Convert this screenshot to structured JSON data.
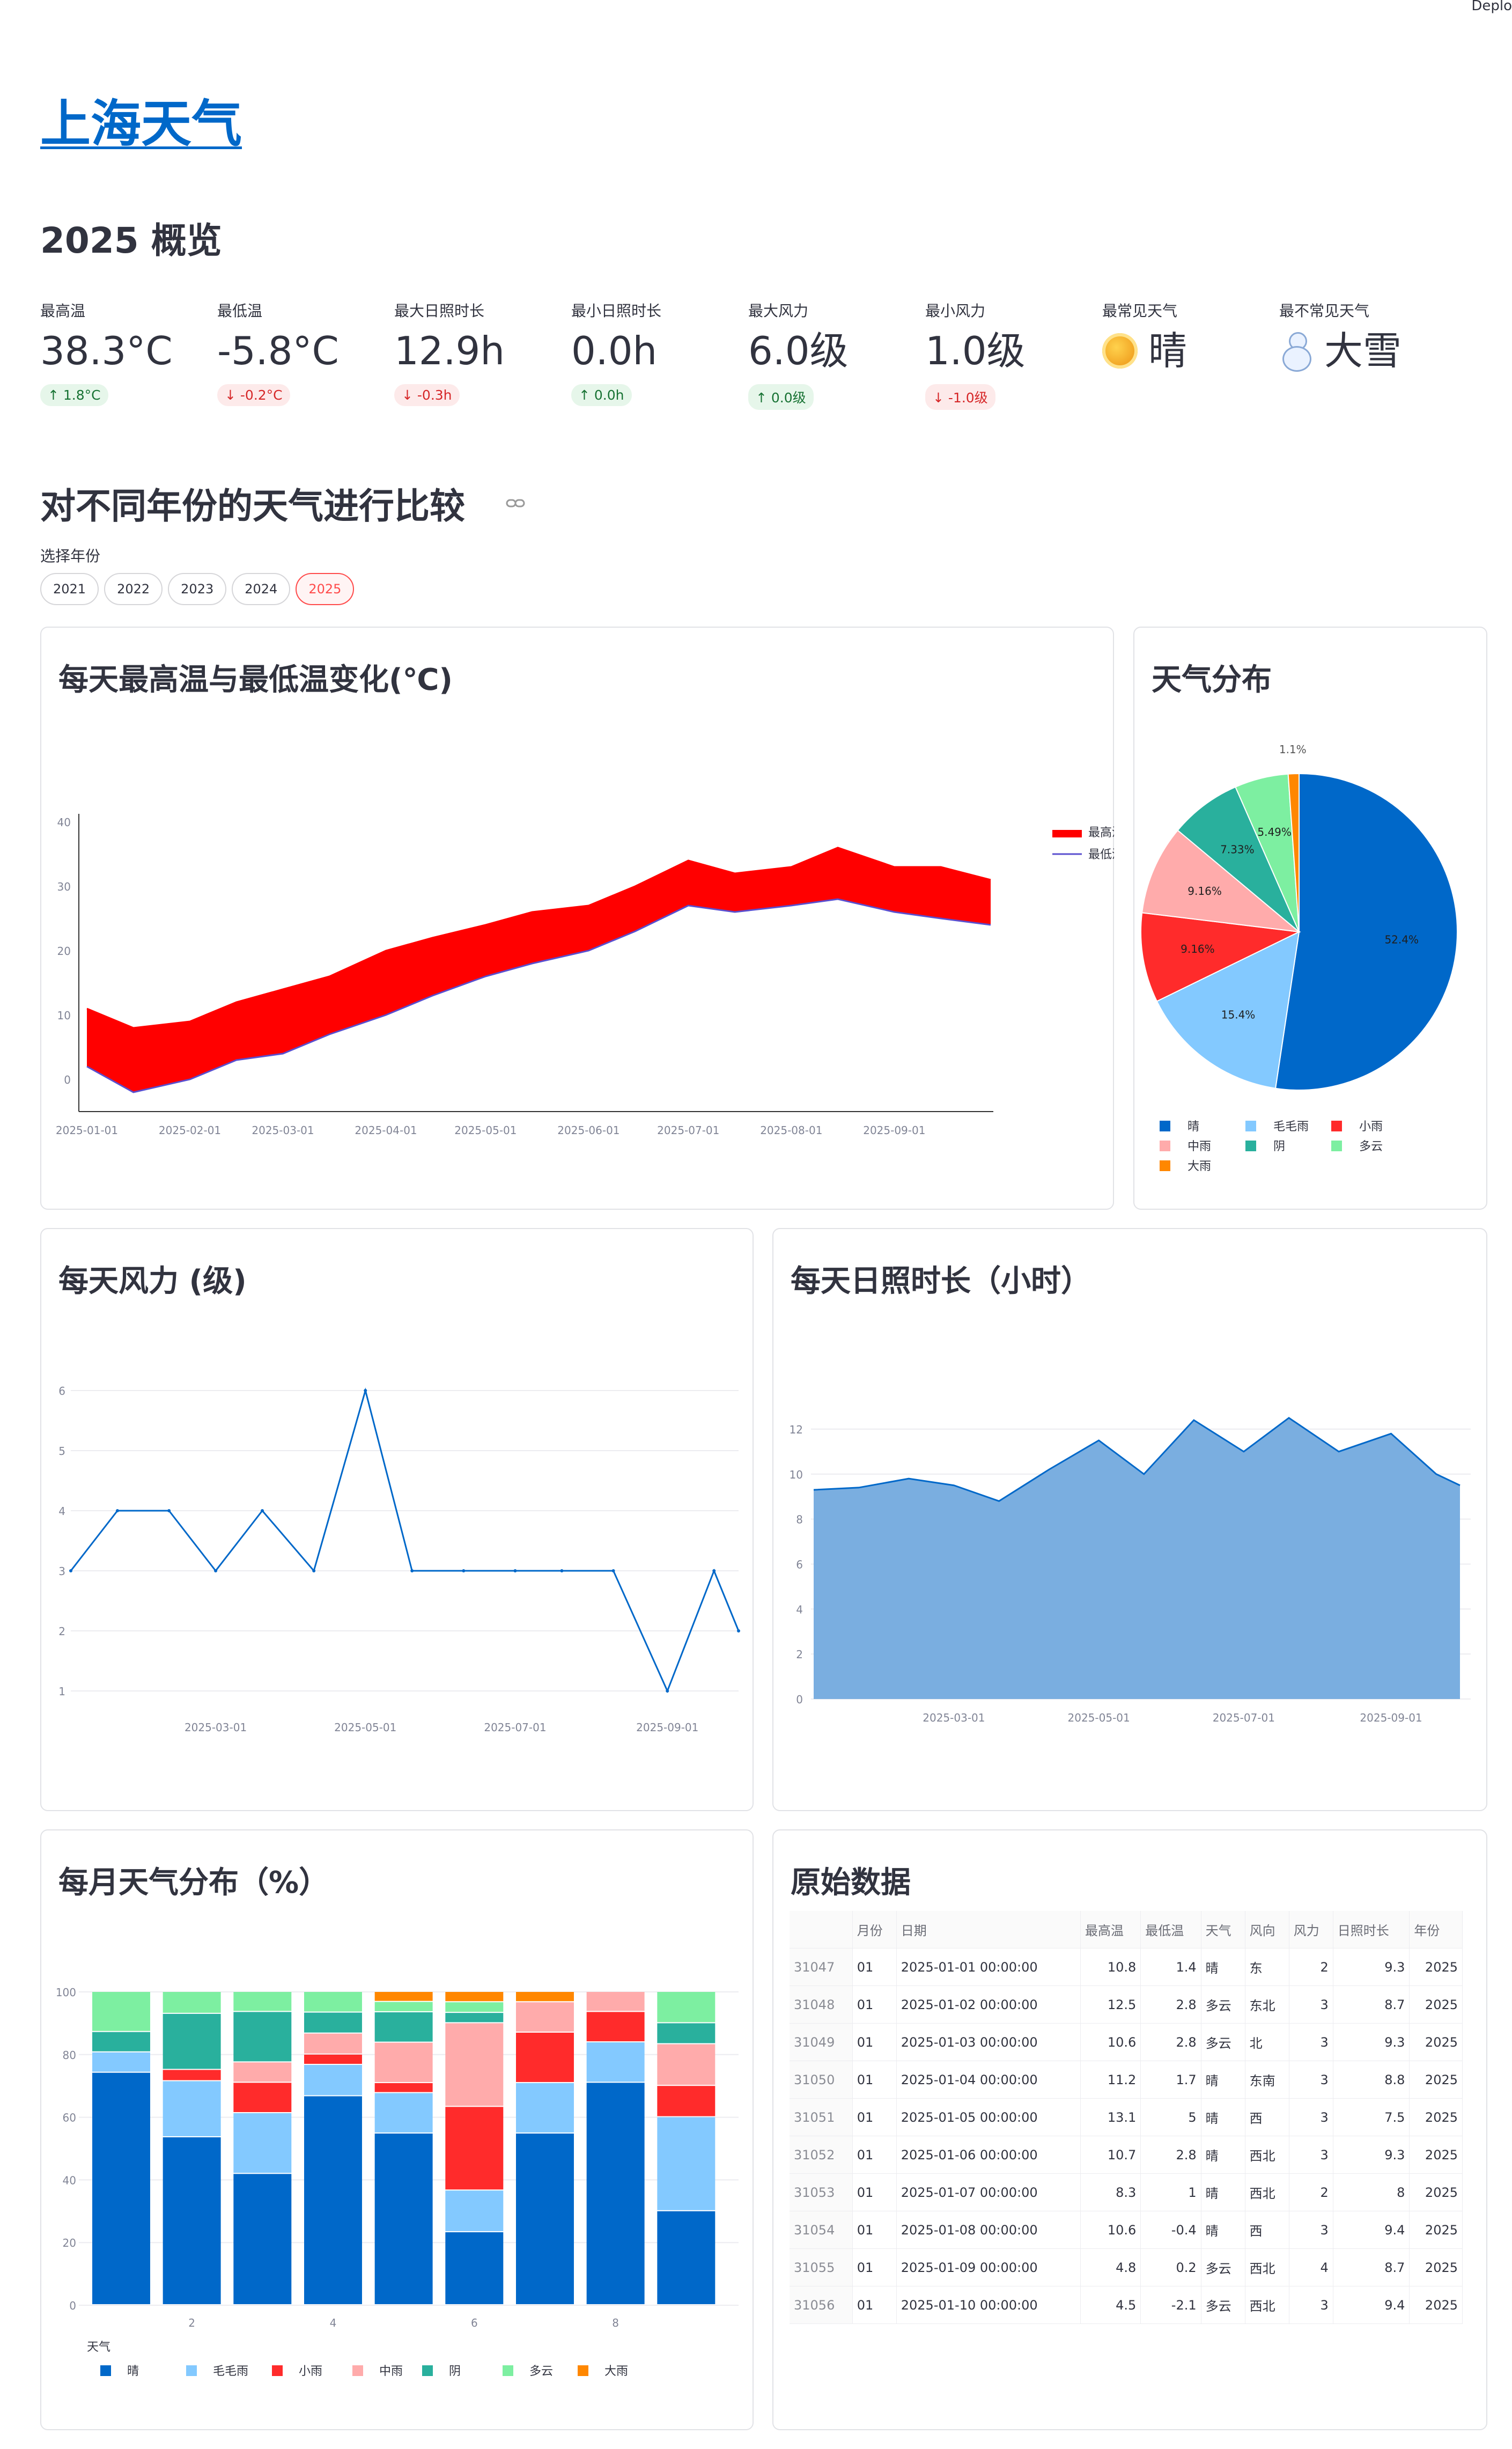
{
  "header": {
    "deploy": "Deplo"
  },
  "title": "上海天气",
  "overview_title": "2025 概览",
  "metrics": [
    {
      "label": "最高温",
      "value": "38.3°C",
      "delta": "1.8°C",
      "dir": "up"
    },
    {
      "label": "最低温",
      "value": "-5.8°C",
      "delta": "-0.2°C",
      "dir": "down"
    },
    {
      "label": "最大日照时长",
      "value": "12.9h",
      "delta": "-0.3h",
      "dir": "down"
    },
    {
      "label": "最小日照时长",
      "value": "0.0h",
      "delta": "0.0h",
      "dir": "up"
    },
    {
      "label": "最大风力",
      "value": "6.0级",
      "delta": "0.0级",
      "dir": "up"
    },
    {
      "label": "最小风力",
      "value": "1.0级",
      "delta": "-1.0级",
      "dir": "down"
    },
    {
      "label": "最常见天气",
      "value": "晴",
      "icon": "sun-icon"
    },
    {
      "label": "最不常见天气",
      "value": "大雪",
      "icon": "snowman-icon"
    }
  ],
  "compare_title": "对不同年份的天气进行比较",
  "year_select": {
    "label": "选择年份",
    "options": [
      "2021",
      "2022",
      "2023",
      "2024",
      "2025"
    ],
    "selected": "2025"
  },
  "colors": {
    "accent": "#ff4b4b",
    "link": "#0068c9",
    "晴": "#0068c9",
    "毛毛雨": "#83c9ff",
    "小雨": "#ff2b2b",
    "中雨": "#ffabab",
    "阴": "#29b09d",
    "多云": "#7defa1",
    "大雨": "#ff8700"
  },
  "panels": {
    "temp": "每天最高温与最低温变化(℃)",
    "pie": "天气分布",
    "wind": "每天风力 (级)",
    "sun": "每天日照时长（小时）",
    "monthly": "每月天气分布（%）",
    "raw": "原始数据"
  },
  "chart_data": [
    {
      "type": "area",
      "title": "每天最高温与最低温变化(℃)",
      "x_ticks": [
        "2025-01-01",
        "2025-02-01",
        "2025-03-01",
        "2025-04-01",
        "2025-05-01",
        "2025-06-01",
        "2025-07-01",
        "2025-08-01",
        "2025-09-01"
      ],
      "ylim": [
        -5,
        40
      ],
      "y_ticks": [
        0,
        10,
        20,
        30,
        40
      ],
      "legend": [
        "最高温",
        "最低温"
      ],
      "x": [
        "2025-01-01",
        "2025-01-15",
        "2025-02-01",
        "2025-02-15",
        "2025-03-01",
        "2025-03-15",
        "2025-04-01",
        "2025-04-15",
        "2025-05-01",
        "2025-05-15",
        "2025-06-01",
        "2025-06-15",
        "2025-07-01",
        "2025-07-15",
        "2025-08-01",
        "2025-08-15",
        "2025-09-01",
        "2025-09-15",
        "2025-09-30"
      ],
      "series": [
        {
          "name": "最高温",
          "values": [
            11,
            8,
            9,
            12,
            14,
            16,
            20,
            22,
            24,
            26,
            27,
            30,
            34,
            32,
            33,
            36,
            33,
            33,
            31
          ]
        },
        {
          "name": "最低温",
          "values": [
            2,
            -2,
            0,
            3,
            4,
            7,
            10,
            13,
            16,
            18,
            20,
            23,
            27,
            26,
            27,
            28,
            26,
            25,
            24
          ]
        }
      ]
    },
    {
      "type": "pie",
      "title": "天气分布",
      "labels": [
        "晴",
        "毛毛雨",
        "小雨",
        "中雨",
        "阴",
        "多云",
        "大雨"
      ],
      "values": [
        52.4,
        15.4,
        9.16,
        9.16,
        7.33,
        5.49,
        1.1
      ],
      "value_labels": [
        "52.4%",
        "15.4%",
        "9.16%",
        "9.16%",
        "7.33%",
        "5.49%",
        "1.1%"
      ]
    },
    {
      "type": "line",
      "title": "每天风力 (级)",
      "x_ticks": [
        "2025-03-01",
        "2025-05-01",
        "2025-07-01",
        "2025-09-01"
      ],
      "ylim": [
        1,
        6
      ],
      "y_ticks": [
        1,
        2,
        3,
        4,
        5,
        6
      ],
      "x": [
        "2025-01-01",
        "2025-01-20",
        "2025-02-10",
        "2025-03-01",
        "2025-03-20",
        "2025-04-10",
        "2025-05-01",
        "2025-05-20",
        "2025-06-10",
        "2025-07-01",
        "2025-07-20",
        "2025-08-10",
        "2025-09-01",
        "2025-09-20",
        "2025-09-30"
      ],
      "values": [
        3,
        4,
        4,
        3,
        4,
        3,
        6,
        3,
        3,
        3,
        3,
        3,
        1,
        3,
        2
      ]
    },
    {
      "type": "area",
      "title": "每天日照时长（小时）",
      "x_ticks": [
        "2025-03-01",
        "2025-05-01",
        "2025-07-01",
        "2025-09-01"
      ],
      "ylim": [
        0,
        13
      ],
      "y_ticks": [
        0,
        2,
        4,
        6,
        8,
        10,
        12
      ],
      "x": [
        "2025-01-01",
        "2025-01-20",
        "2025-02-10",
        "2025-03-01",
        "2025-03-20",
        "2025-04-10",
        "2025-05-01",
        "2025-05-20",
        "2025-06-10",
        "2025-07-01",
        "2025-07-20",
        "2025-08-10",
        "2025-09-01",
        "2025-09-20",
        "2025-09-30"
      ],
      "values": [
        9.3,
        9.4,
        9.8,
        9.5,
        8.8,
        10.2,
        11.5,
        10.0,
        12.4,
        11.0,
        12.5,
        11.0,
        11.8,
        10.0,
        9.5
      ]
    },
    {
      "type": "bar",
      "title": "每月天气分布（%）",
      "stacked": true,
      "categories": [
        "1",
        "2",
        "3",
        "4",
        "5",
        "6",
        "7",
        "8",
        "9"
      ],
      "x_ticks": [
        "2",
        "4",
        "6",
        "8"
      ],
      "ylim": [
        0,
        100
      ],
      "y_ticks": [
        0,
        20,
        40,
        60,
        80,
        100
      ],
      "legend_title": "天气",
      "series": [
        {
          "name": "晴",
          "values": [
            74.2,
            53.6,
            41.9,
            66.7,
            54.8,
            23.3,
            54.8,
            71.0,
            30.0
          ]
        },
        {
          "name": "毛毛雨",
          "values": [
            6.5,
            17.9,
            19.4,
            10.0,
            12.9,
            13.3,
            16.1,
            12.9,
            30.0
          ]
        },
        {
          "name": "小雨",
          "values": [
            0,
            3.6,
            9.7,
            3.3,
            3.2,
            26.7,
            16.1,
            9.7,
            10.0
          ]
        },
        {
          "name": "中雨",
          "values": [
            0,
            0,
            6.5,
            6.7,
            12.9,
            26.7,
            9.7,
            6.4,
            13.3
          ]
        },
        {
          "name": "阴",
          "values": [
            6.5,
            17.9,
            16.1,
            6.7,
            9.7,
            3.3,
            0,
            0,
            6.7
          ]
        },
        {
          "name": "多云",
          "values": [
            12.8,
            7.0,
            6.4,
            6.6,
            3.3,
            3.4,
            0,
            0,
            10.0
          ]
        },
        {
          "name": "大雨",
          "values": [
            0,
            0,
            0,
            0,
            3.2,
            3.3,
            3.3,
            0,
            0
          ]
        }
      ]
    }
  ],
  "raw_table": {
    "columns": [
      "",
      "月份",
      "日期",
      "最高温",
      "最低温",
      "天气",
      "风向",
      "风力",
      "日照时长",
      "年份"
    ],
    "rows": [
      [
        "31047",
        "01",
        "2025-01-01 00:00:00",
        "10.8",
        "1.4",
        "晴",
        "东",
        "2",
        "9.3",
        "2025"
      ],
      [
        "31048",
        "01",
        "2025-01-02 00:00:00",
        "12.5",
        "2.8",
        "多云",
        "东北",
        "3",
        "8.7",
        "2025"
      ],
      [
        "31049",
        "01",
        "2025-01-03 00:00:00",
        "10.6",
        "2.8",
        "多云",
        "北",
        "3",
        "9.3",
        "2025"
      ],
      [
        "31050",
        "01",
        "2025-01-04 00:00:00",
        "11.2",
        "1.7",
        "晴",
        "东南",
        "3",
        "8.8",
        "2025"
      ],
      [
        "31051",
        "01",
        "2025-01-05 00:00:00",
        "13.1",
        "5",
        "晴",
        "西",
        "3",
        "7.5",
        "2025"
      ],
      [
        "31052",
        "01",
        "2025-01-06 00:00:00",
        "10.7",
        "2.8",
        "晴",
        "西北",
        "3",
        "9.3",
        "2025"
      ],
      [
        "31053",
        "01",
        "2025-01-07 00:00:00",
        "8.3",
        "1",
        "晴",
        "西北",
        "2",
        "8",
        "2025"
      ],
      [
        "31054",
        "01",
        "2025-01-08 00:00:00",
        "10.6",
        "-0.4",
        "晴",
        "西",
        "3",
        "9.4",
        "2025"
      ],
      [
        "31055",
        "01",
        "2025-01-09 00:00:00",
        "4.8",
        "0.2",
        "多云",
        "西北",
        "4",
        "8.7",
        "2025"
      ],
      [
        "31056",
        "01",
        "2025-01-10 00:00:00",
        "4.5",
        "-2.1",
        "多云",
        "西北",
        "3",
        "9.4",
        "2025"
      ]
    ]
  }
}
